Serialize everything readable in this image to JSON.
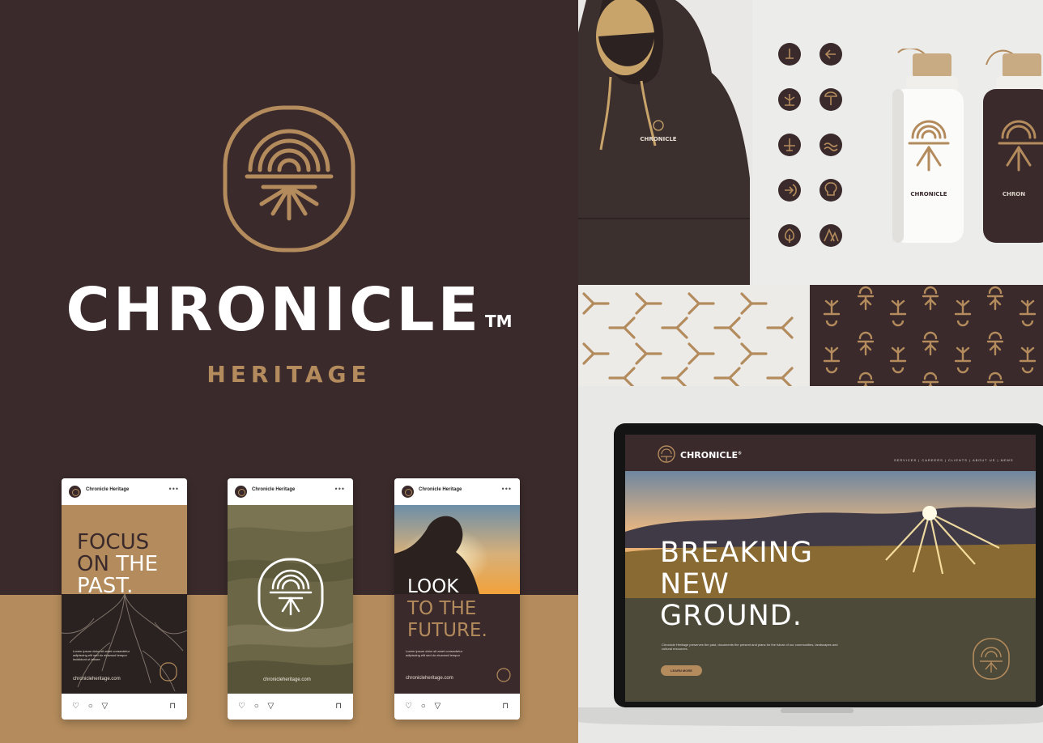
{
  "brand": {
    "name": "CHRONICLE",
    "trademark": "TM",
    "tagline": "HERITAGE"
  },
  "colors": {
    "brown": "#3a2a2b",
    "gold": "#b38b5c",
    "olive": "#4d4a39",
    "cream": "#ffffff"
  },
  "social_posts": [
    {
      "account": "Chronicle Heritage",
      "menu": "•••",
      "headline_line1": "FOCUS",
      "headline_line2_a": "ON",
      "headline_line2_b": "THE",
      "headline_line3": "PAST.",
      "body": "Lorem ipsum dolor sit amet consectetur adipiscing elit sed do eiusmod tempor incididunt ut labore",
      "url": "chronicleheritage.com",
      "footer_icons": "♡ ○ ▽",
      "save_icon": "⊓"
    },
    {
      "account": "Chronicle Heritage",
      "menu": "•••",
      "url": "chronicleheritage.com",
      "footer_icons": "♡ ○ ▽",
      "save_icon": "⊓"
    },
    {
      "account": "Chronicle Heritage",
      "menu": "•••",
      "headline_line1": "LOOK",
      "headline_line2": "TO THE",
      "headline_line3": "FUTURE.",
      "body": "Lorem ipsum dolor sit amet consectetur adipiscing elit sed do eiusmod tempor",
      "url": "chronicleheritage.com",
      "footer_icons": "♡ ○ ▽",
      "save_icon": "⊓"
    }
  ],
  "merch": {
    "hoodie_logo": "CHRONICLE",
    "bottle_white_logo": "CHRONICLE",
    "bottle_dark_logo": "CHRON"
  },
  "website": {
    "logo_text": "CHRONICLE",
    "logo_tm": "®",
    "nav": "SERVICES | CAREERS | CLIENTS | ABOUT US | NEWS",
    "headline_line1": "BREAKING",
    "headline_line2": "NEW",
    "headline_line3": "GROUND.",
    "body": "Chronicle Heritage preserves the past, documents the present and plans for the future of our communities, landscapes and cultural resources.",
    "cta": "LEARN MORE"
  },
  "icon_set": [
    "pin-icon",
    "arrow-left-icon",
    "root-icon",
    "tree-icon",
    "plane-icon",
    "water-icon",
    "enter-icon",
    "bulb-icon",
    "leaf-icon",
    "mountain-icon"
  ]
}
